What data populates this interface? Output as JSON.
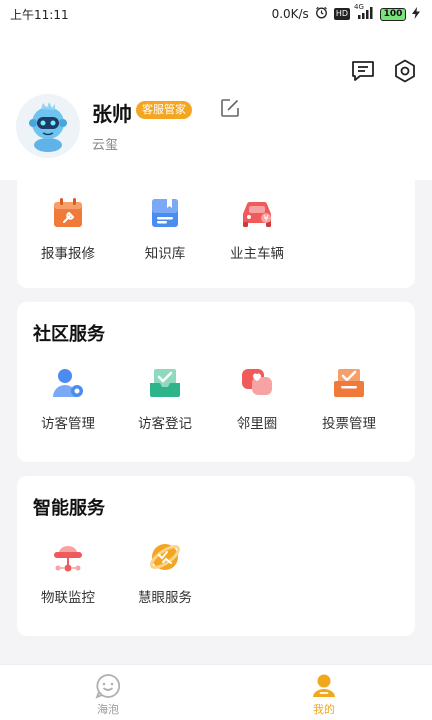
{
  "status_bar": {
    "time": "上午11:11",
    "net_speed": "0.0K/s",
    "network_type": "4G",
    "battery": "100"
  },
  "profile": {
    "name": "张帅",
    "role": "客服管家",
    "org": "云玺"
  },
  "top_section": {
    "items": [
      {
        "label": "报事报修",
        "icon": "repair-calendar-icon",
        "color": "#f07a3a"
      },
      {
        "label": "知识库",
        "icon": "knowledge-book-icon",
        "color": "#4a8cf0"
      },
      {
        "label": "业主车辆",
        "icon": "car-icon",
        "color": "#f05a5a"
      }
    ]
  },
  "community_services": {
    "title": "社区服务",
    "items": [
      {
        "label": "访客管理",
        "icon": "visitor-manage-icon",
        "color": "#4a8cf0"
      },
      {
        "label": "访客登记",
        "icon": "visitor-register-icon",
        "color": "#2fb38a"
      },
      {
        "label": "邻里圈",
        "icon": "neighbor-chat-icon",
        "color": "#f05a5a"
      },
      {
        "label": "投票管理",
        "icon": "vote-icon",
        "color": "#f07a3a"
      }
    ]
  },
  "smart_services": {
    "title": "智能服务",
    "items": [
      {
        "label": "物联监控",
        "icon": "iot-monitor-icon",
        "color": "#f05a5a"
      },
      {
        "label": "慧眼服务",
        "icon": "eye-service-icon",
        "color": "#f4a623"
      }
    ]
  },
  "bottom_nav": {
    "tabs": [
      {
        "label": "海泡",
        "active": false
      },
      {
        "label": "我的",
        "active": true
      }
    ]
  },
  "colors": {
    "accent": "#f0a81c",
    "badge": "#f4a623",
    "background": "#f4f4f6"
  }
}
